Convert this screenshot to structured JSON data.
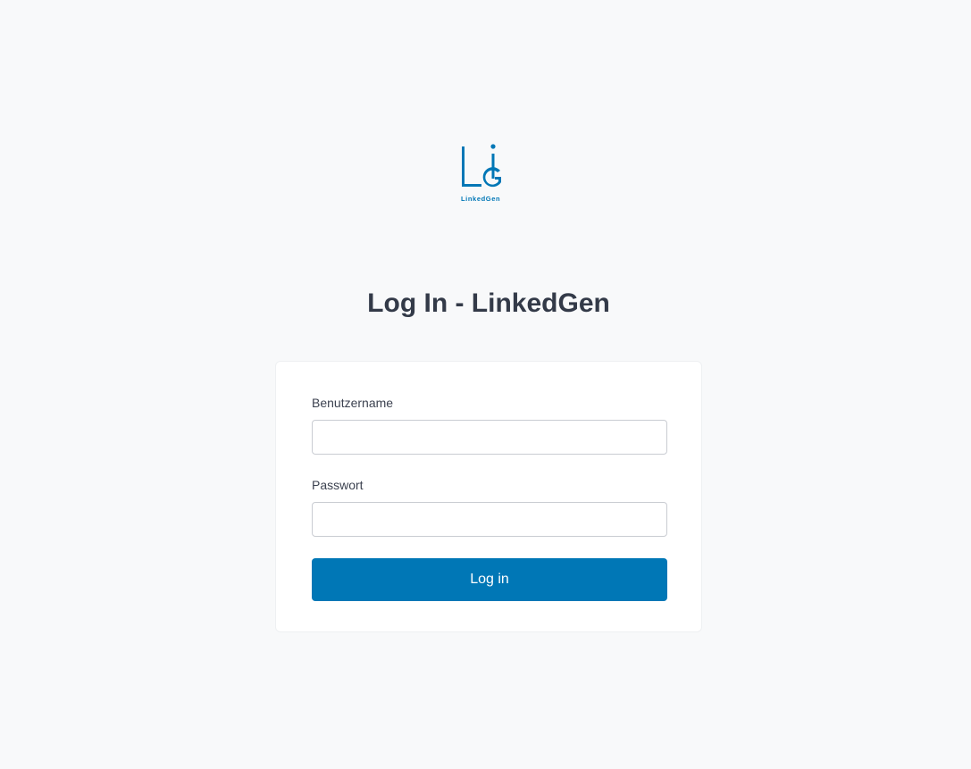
{
  "brand": {
    "logo_icon": "linkedgen-logo",
    "logo_text": "LinkedGen",
    "color": "#0077b6"
  },
  "page": {
    "title": "Log In - LinkedGen"
  },
  "form": {
    "username": {
      "label": "Benutzername",
      "value": "",
      "placeholder": ""
    },
    "password": {
      "label": "Passwort",
      "value": "",
      "placeholder": ""
    },
    "submit_label": "Log in"
  }
}
